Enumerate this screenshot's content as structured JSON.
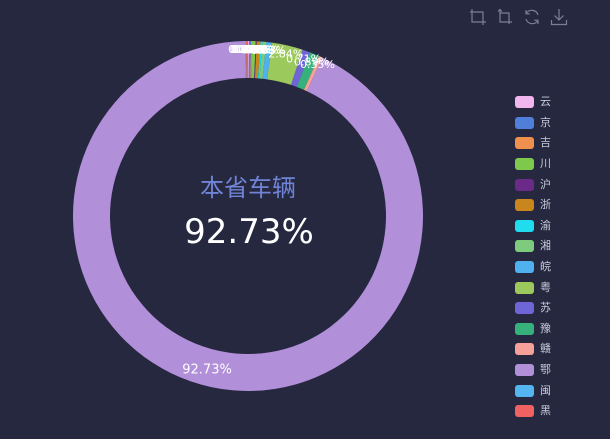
{
  "toolbox": [
    {
      "name": "zoom-select-icon"
    },
    {
      "name": "zoom-reset-icon"
    },
    {
      "name": "restore-icon"
    },
    {
      "name": "download-icon"
    }
  ],
  "center": {
    "label": "本省车辆",
    "value": "92.73%"
  },
  "chart_data": {
    "type": "pie",
    "title": "",
    "center_label": "本省车辆",
    "center_value": "92.73%",
    "series": [
      {
        "name": "云",
        "value": 0.09,
        "color": "#f2b6ee"
      },
      {
        "name": "京",
        "value": 0.18,
        "color": "#4f7fd8"
      },
      {
        "name": "吉",
        "value": 0.09,
        "color": "#f0904e"
      },
      {
        "name": "川",
        "value": 0.35,
        "color": "#7ec94b"
      },
      {
        "name": "沪",
        "value": 0.09,
        "color": "#6a2a88"
      },
      {
        "name": "浙",
        "value": 0.35,
        "color": "#c8861c"
      },
      {
        "name": "渝",
        "value": 0.18,
        "color": "#1fdcef"
      },
      {
        "name": "湘",
        "value": 0.35,
        "color": "#7fcb7e"
      },
      {
        "name": "皖",
        "value": 0.53,
        "color": "#4fb2ee"
      },
      {
        "name": "粤",
        "value": 2.84,
        "color": "#9bc95b"
      },
      {
        "name": "苏",
        "value": 0.71,
        "color": "#6e66d6"
      },
      {
        "name": "豫",
        "value": 0.89,
        "color": "#36b17c"
      },
      {
        "name": "赣",
        "value": 0.35,
        "color": "#f6a09a"
      },
      {
        "name": "鄂",
        "value": 92.73,
        "color": "#b18fd9"
      },
      {
        "name": "闽",
        "value": 0.09,
        "color": "#55b5f0"
      },
      {
        "name": "黑",
        "value": 0.18,
        "color": "#f06262"
      }
    ],
    "slice_labels": [
      "0.09%",
      "0.18%",
      "0.09%",
      "0.35%",
      "0.09%",
      "0.35%",
      "0.18%",
      "0.35%",
      "0.53%",
      "2.84%",
      "0.71%",
      "0.89%",
      "0.35%",
      "92.73%",
      "0.09%",
      "0.18%"
    ],
    "legend_position": "right"
  }
}
